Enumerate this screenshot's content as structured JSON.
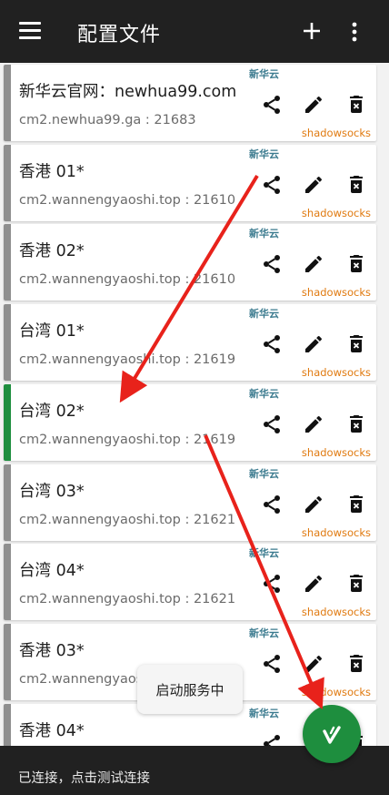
{
  "appbar": {
    "title": "配置文件",
    "menu_icon": "hamburger-menu-icon",
    "add_icon": "plus-icon",
    "more_icon": "more-vertical-icon"
  },
  "servers": [
    {
      "name": "新华云官网：newhua99.com",
      "address": "cm2.newhua99.ga : 21683",
      "subscription": "新华云",
      "type": "shadowsocks",
      "active": false
    },
    {
      "name": "香港 01*",
      "address": "cm2.wannengyaoshi.top : 21610",
      "subscription": "新华云",
      "type": "shadowsocks",
      "active": false
    },
    {
      "name": "香港 02*",
      "address": "cm2.wannengyaoshi.top : 21610",
      "subscription": "新华云",
      "type": "shadowsocks",
      "active": false
    },
    {
      "name": "台湾 01*",
      "address": "cm2.wannengyaoshi.top : 21619",
      "subscription": "新华云",
      "type": "shadowsocks",
      "active": false
    },
    {
      "name": "台湾 02*",
      "address": "cm2.wannengyaoshi.top : 21619",
      "subscription": "新华云",
      "type": "shadowsocks",
      "active": true
    },
    {
      "name": "台湾 03*",
      "address": "cm2.wannengyaoshi.top : 21621",
      "subscription": "新华云",
      "type": "shadowsocks",
      "active": false
    },
    {
      "name": "台湾 04*",
      "address": "cm2.wannengyaoshi.top : 21621",
      "subscription": "新华云",
      "type": "shadowsocks",
      "active": false
    },
    {
      "name": "香港 03*",
      "address": "cm2.wannengyaoshi.top",
      "subscription": "新华云",
      "type": "shadowsocks",
      "active": false
    },
    {
      "name": "香港 04*",
      "address": "",
      "subscription": "新华云",
      "type": "",
      "active": false
    }
  ],
  "toast": {
    "text": "启动服务中"
  },
  "status_bar": {
    "text": "已连接，点击测试连接"
  },
  "fab": {
    "icon": "connect-vpn-icon",
    "color": "#1e8e3e"
  },
  "colors": {
    "active_strip": "#1e8e3e",
    "inactive_strip": "#8f8f8f",
    "type_label": "#e07a10",
    "subscription_label": "#3a7a8e",
    "annotation_arrow": "#e8221b"
  }
}
